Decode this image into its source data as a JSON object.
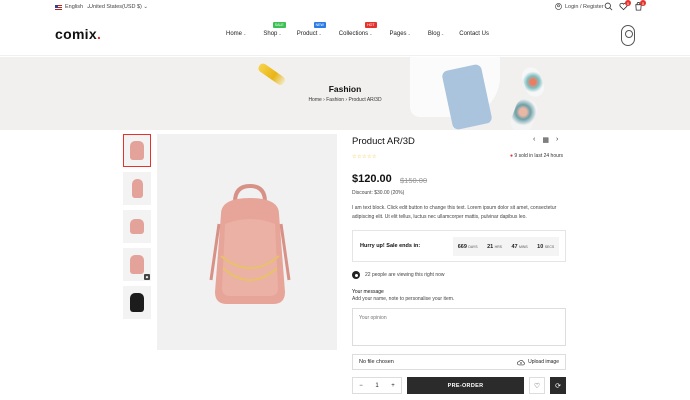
{
  "topbar": {
    "language": "English",
    "currency": "United States(USD $)",
    "login": "Login / Register",
    "wishlist_count": "0",
    "cart_count": "0"
  },
  "header": {
    "logo": "comix",
    "nav": [
      {
        "label": "Home",
        "tag": "",
        "tag_color": ""
      },
      {
        "label": "Shop",
        "tag": "SALE",
        "tag_color": "#3cbf53"
      },
      {
        "label": "Product",
        "tag": "NEW",
        "tag_color": "#2a7be4"
      },
      {
        "label": "Collections",
        "tag": "HOT",
        "tag_color": "#e5322d"
      },
      {
        "label": "Pages",
        "tag": "",
        "tag_color": ""
      },
      {
        "label": "Blog",
        "tag": "",
        "tag_color": ""
      },
      {
        "label": "Contact Us",
        "tag": "",
        "tag_color": ""
      }
    ]
  },
  "banner": {
    "title": "Fashion",
    "breadcrumb": [
      "Home",
      "Fashion",
      "Product AR/3D"
    ]
  },
  "product": {
    "title": "Product AR/3D",
    "rating_stars": "☆☆☆☆☆",
    "sold": "9 sold in last 24 hours",
    "price": "$120.00",
    "old_price": "$150.00",
    "discount": "Discount: $30.00 (20%)",
    "description": "I am text block. Click edit button to change this text. Lorem ipsum dolor sit amet, consectetur adipiscing elit. Ut elit tellus, luctus nec ullamcorper mattis, pulvinar dapibus leo.",
    "hurry": "Hurry up! Sale ends in:",
    "timer": [
      {
        "value": "669",
        "unit": "DAYS"
      },
      {
        "value": "21",
        "unit": "HRS"
      },
      {
        "value": "47",
        "unit": "MINS"
      },
      {
        "value": "10",
        "unit": "SECS"
      }
    ],
    "viewers": "22 people are viewing this right now",
    "message_label": "Your message",
    "message_help": "Add your name, note to personalise your item.",
    "message_placeholder": "Your opinion",
    "file_status": "No file chosen",
    "upload_label": "Upload image",
    "quantity": "1",
    "preorder_label": "PRE-ORDER"
  },
  "colors": {
    "accent": "#e5322d",
    "dark": "#2b2b2b"
  }
}
